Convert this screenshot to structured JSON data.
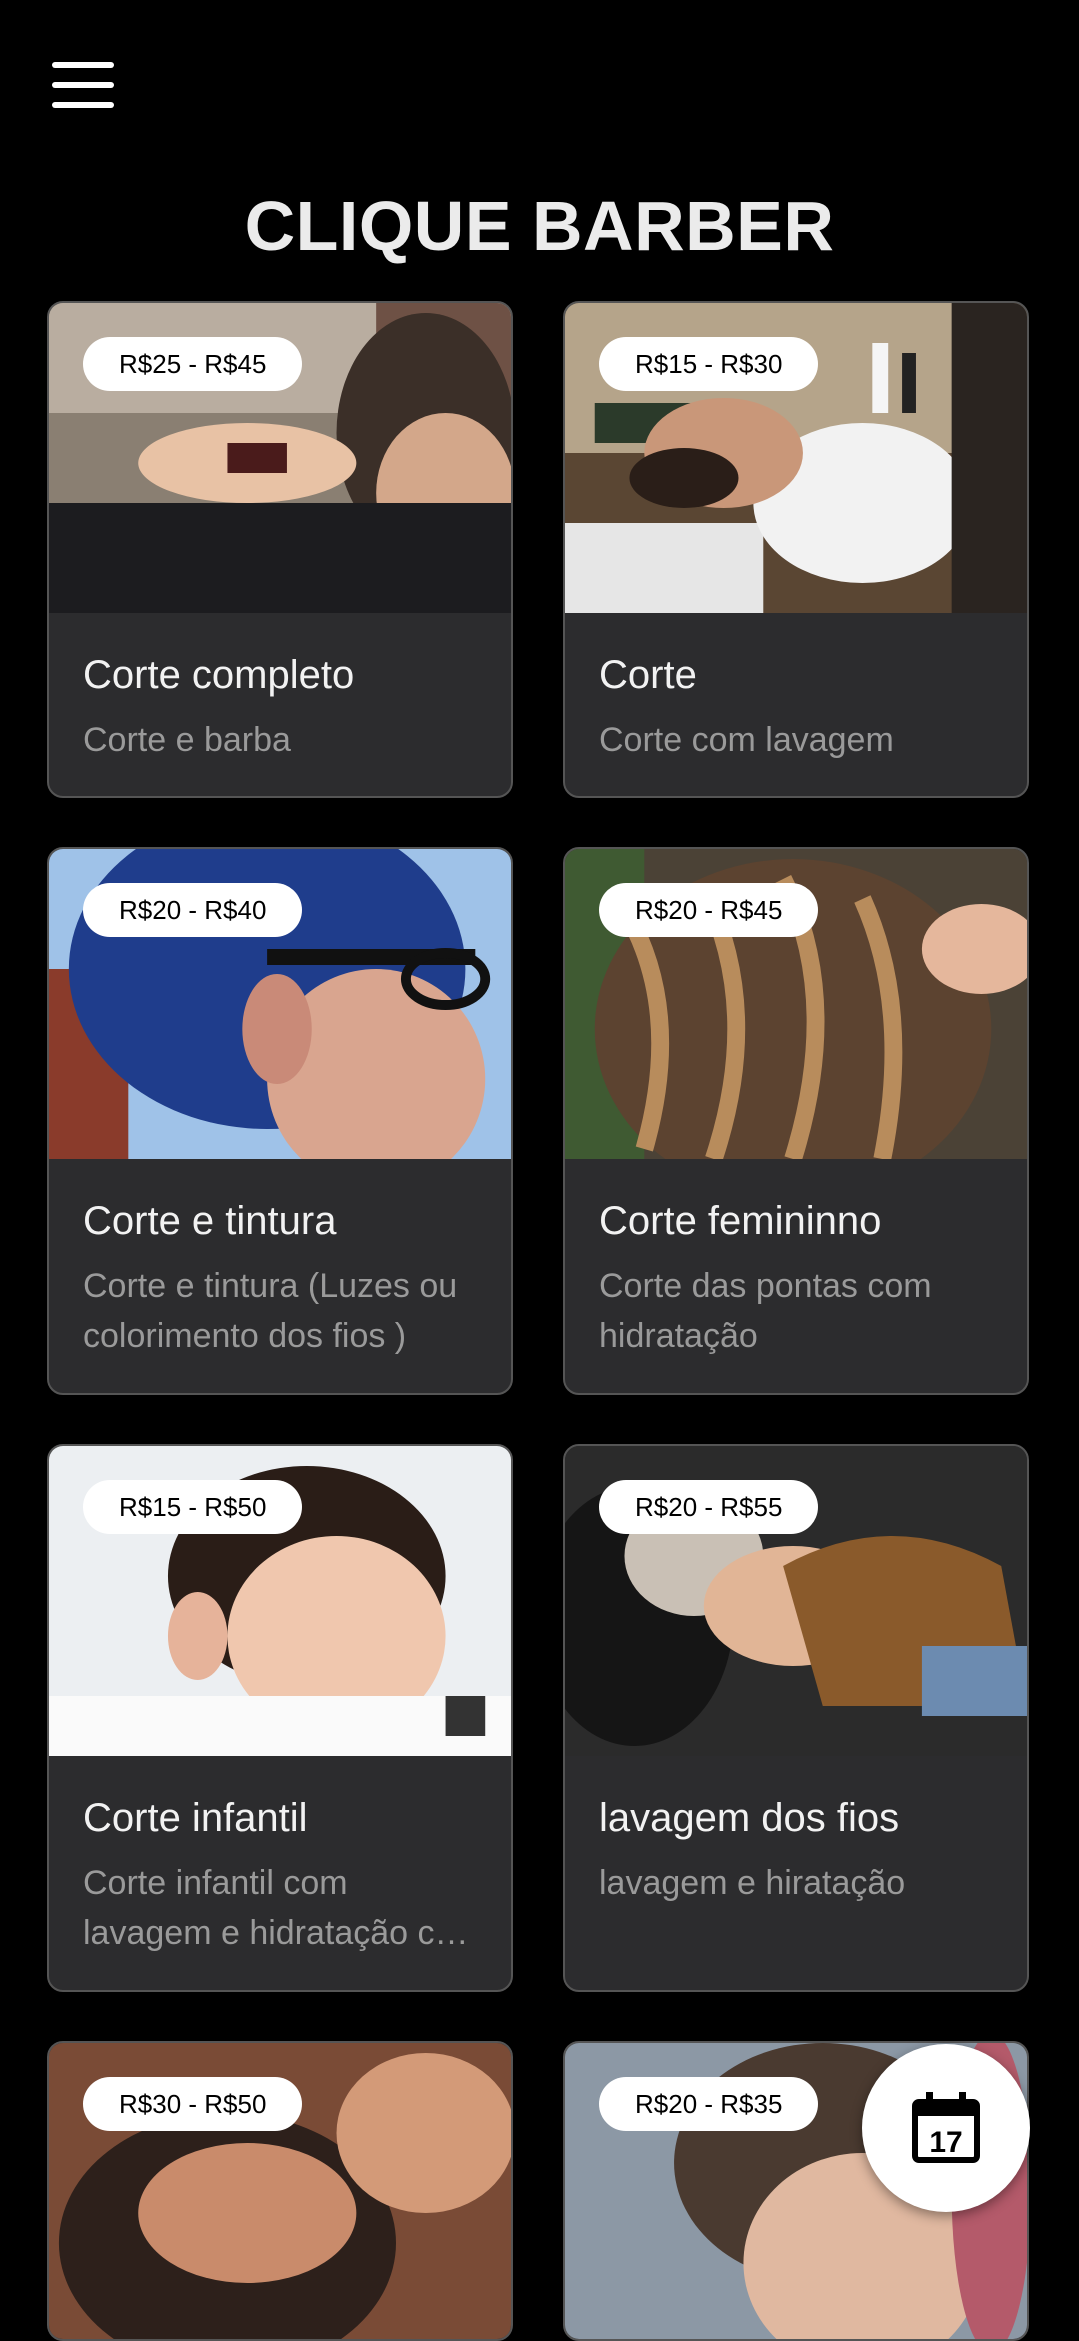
{
  "header": {
    "title": "CLIQUE BARBER",
    "menu_icon": "hamburger-menu-icon"
  },
  "services": [
    {
      "price": "R$25 - R$45",
      "name": "Corte completo",
      "description": "Corte e barba"
    },
    {
      "price": "R$15 - R$30",
      "name": "Corte",
      "description": "Corte com lavagem"
    },
    {
      "price": "R$20 - R$40",
      "name": "Corte e tintura",
      "description": "Corte e tintura (Luzes ou colorimento dos fios )"
    },
    {
      "price": "R$20 - R$45",
      "name": "Corte femininno",
      "description": "Corte das pontas com hidratação"
    },
    {
      "price": "R$15 - R$50",
      "name": "Corte infantil",
      "description": "Corte infantil com lavagem e hidratação com produtos"
    },
    {
      "price": "R$20 - R$55",
      "name": "lavagem dos fios",
      "description": "lavagem e hiratação"
    },
    {
      "price": "R$30 - R$50"
    },
    {
      "price": "R$20 - R$35"
    }
  ],
  "fab": {
    "icon": "calendar-icon",
    "day": "17"
  }
}
